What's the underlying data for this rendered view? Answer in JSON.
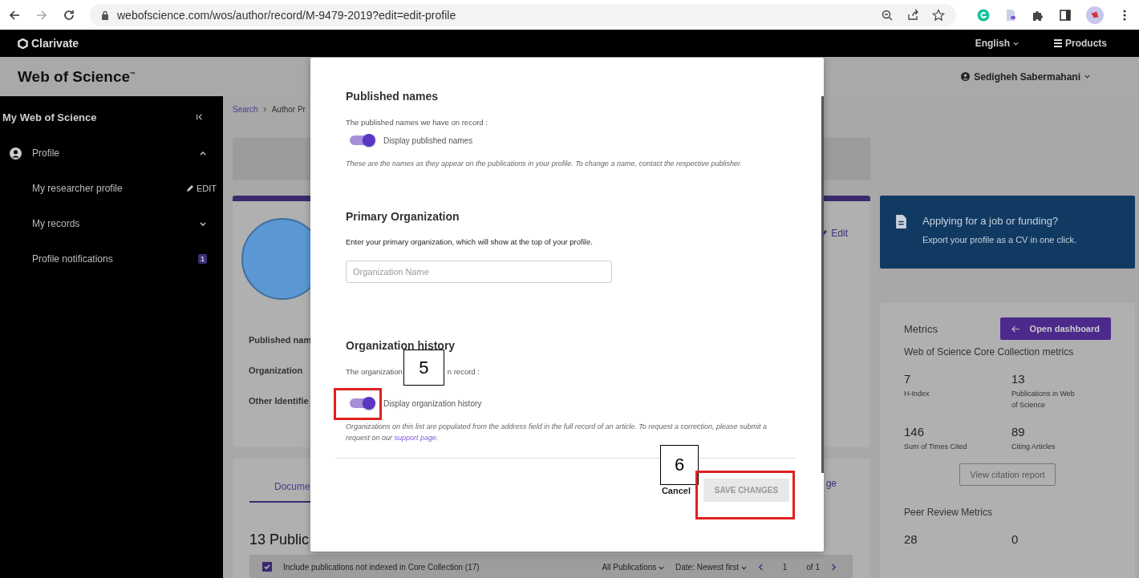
{
  "browser": {
    "url": "webofscience.com/wos/author/record/M-9479-2019?edit=edit-profile"
  },
  "topbar": {
    "logo": "Clarivate",
    "language": "English",
    "products": "Products"
  },
  "header": {
    "title": "Web of Science",
    "trademark": "™",
    "user": "Sedigheh Sabermahani"
  },
  "sidebar": {
    "title": "My Web of Science",
    "section": {
      "label": "Profile",
      "expanded": true
    },
    "items": [
      {
        "kind": "edit",
        "label": "My researcher profile",
        "action": "EDIT"
      },
      {
        "kind": "expander",
        "label": "My records",
        "expanded": false
      },
      {
        "kind": "badge",
        "label": "Profile notifications",
        "badge": "1"
      }
    ]
  },
  "breadcrumb": [
    "Search",
    "Author Pr"
  ],
  "profile_card": {
    "labels": [
      "Published nam",
      "Organization",
      "Other Identifie"
    ],
    "edit": "Edit"
  },
  "documents": {
    "tab": "Docume",
    "heading": "13 Public",
    "link_fragment": "ge",
    "include": {
      "label": "Include publications not indexed in Core Collection (17)",
      "checked": true
    },
    "filter": "All Publications",
    "sort": "Date: Newest first",
    "page": "1",
    "of": "of 1"
  },
  "cv_banner": {
    "title": "Applying for a job or funding?",
    "text": "Export your profile as a CV in one click."
  },
  "metrics": {
    "title": "Metrics",
    "button": "Open dashboard",
    "subtitle": "Web of Science Core Collection metrics",
    "items": [
      {
        "value": "7",
        "label": "H-Index"
      },
      {
        "value": "13",
        "label": "Publications in Web of Science"
      },
      {
        "value": "146",
        "label": "Sum of Times Cited"
      },
      {
        "value": "89",
        "label": "Citing Articles"
      }
    ],
    "report_button": "View citation report",
    "peer_title": "Peer Review Metrics",
    "peer_values": [
      "28",
      "0"
    ]
  },
  "modal": {
    "sections": [
      {
        "kind": "toggle",
        "title": "Published names",
        "intro": [
          "The published names we have on record :"
        ],
        "toggle": {
          "label": "Display published names",
          "on": true
        },
        "note": "These are the names as they appear on the publications in your profile. To change a name, contact the respective publisher."
      },
      {
        "kind": "input",
        "title": "Primary Organization",
        "intro": [
          "Enter your primary organization, which will show at the top of your profile."
        ],
        "placeholder": "Organization Name"
      },
      {
        "kind": "toggle",
        "title": "Organization history",
        "intro": [
          "The organization",
          "n record :"
        ],
        "callout": "5",
        "toggle": {
          "label": "Display organization history",
          "on": true,
          "highlighted": true
        },
        "note": "Organizations on this list are populated from the address field in the full record of an article. To request a correction, please submit a request on our",
        "link": "support page."
      }
    ],
    "cancel": "Cancel",
    "save": {
      "label": "SAVE CHANGES",
      "disabled": true,
      "highlighted": true
    },
    "callout": "6"
  }
}
